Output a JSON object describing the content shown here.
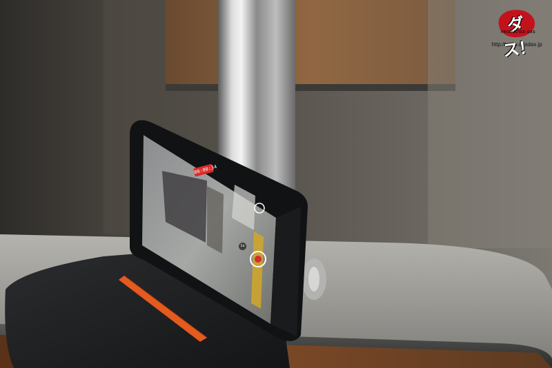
{
  "photo": {
    "subject": "smartphone-recording-on-turnstile"
  },
  "watermark": {
    "logo_text": "ダス！",
    "logo_subtext": "PRODUCTED DAS",
    "url": "http://www.dasdas.jp",
    "brand_color": "#c4121d"
  },
  "phone_screen": {
    "timer": "00:00:34",
    "zoom_label": "1x",
    "record_color": "#d92a2a"
  },
  "colors": {
    "background_wall": "#3a3733",
    "wood_panel": "#8a5a34",
    "steel_pole": "#a9a9a9",
    "case_leather": "#1c1d1f",
    "case_accent": "#e45a1f",
    "counter_steel": "#8d8d8b"
  }
}
